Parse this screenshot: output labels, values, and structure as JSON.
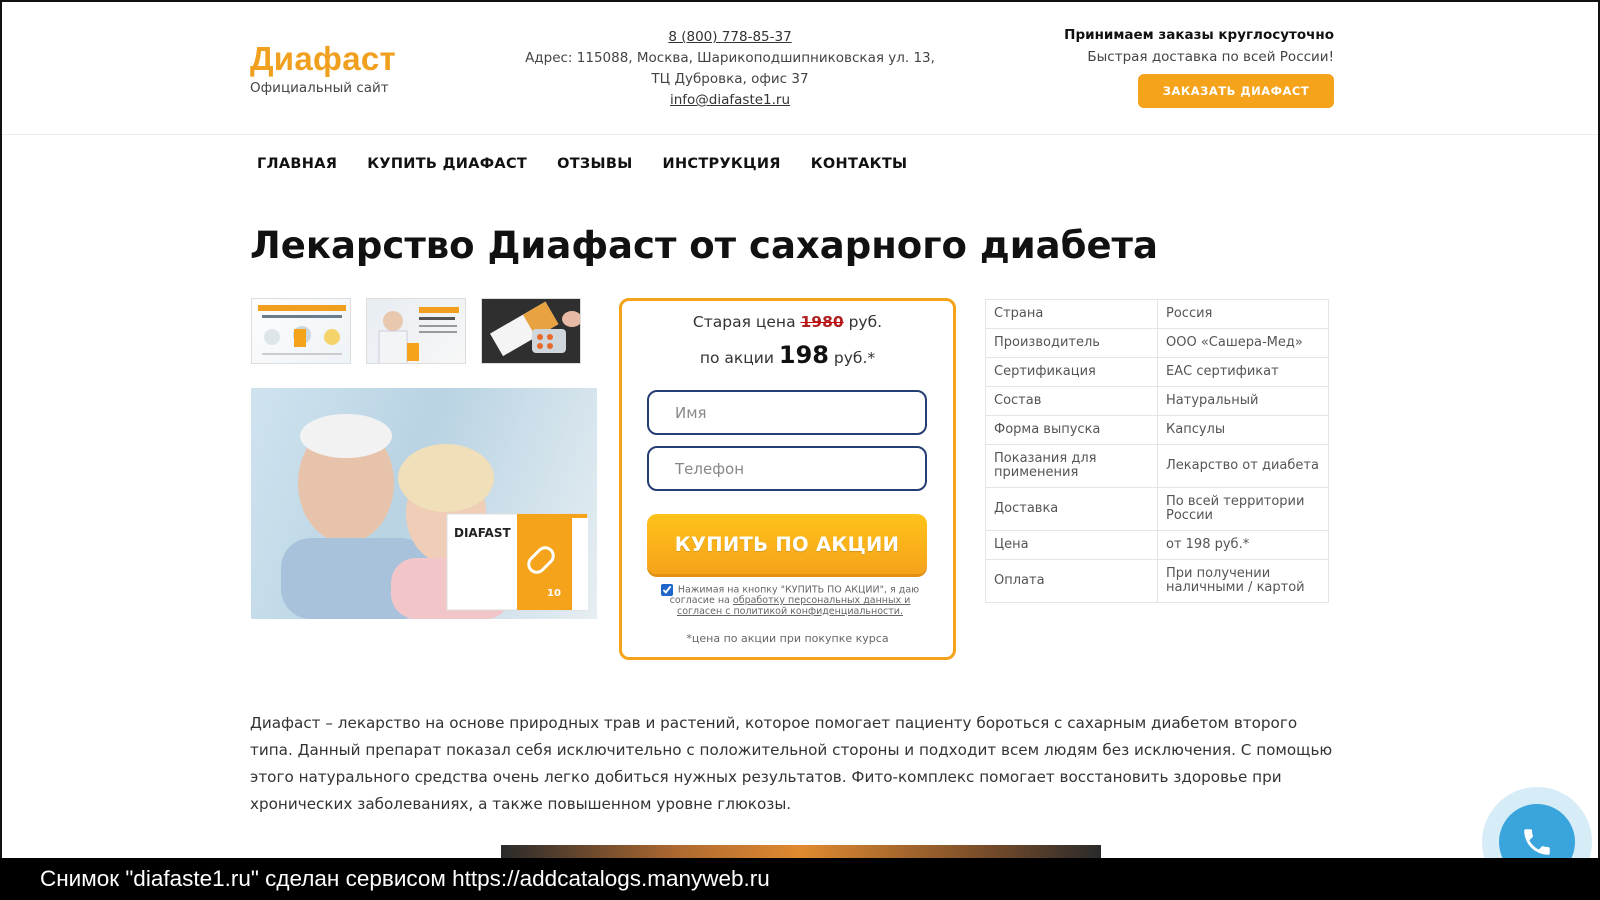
{
  "header": {
    "logo_title": "Диафаст",
    "logo_subtitle": "Официальный сайт",
    "phone": "8 (800) 778-85-37",
    "address_line1": "Адрес: 115088, Москва, Шарикоподшипниковская ул. 13,",
    "address_line2": "ТЦ Дубровка, офис 37",
    "email": "info@diafaste1.ru",
    "order_title": "Принимаем заказы круглосуточно",
    "order_subtitle": "Быстрая доставка по всей России!",
    "order_button": "ЗАКАЗАТЬ ДИАФАСТ"
  },
  "nav": {
    "items": [
      "ГЛАВНАЯ",
      "КУПИТЬ ДИАФАСТ",
      "ОТЗЫВЫ",
      "ИНСТРУКЦИЯ",
      "КОНТАКТЫ"
    ]
  },
  "page_title": "Лекарство Диафаст от сахарного диабета",
  "product_image": {
    "box_label": "DIAFAST",
    "box_count": "10"
  },
  "form": {
    "old_price_prefix": "Старая цена",
    "old_price_value": "1980",
    "currency": "руб.",
    "promo_prefix": "по акции",
    "promo_value": "198",
    "promo_currency": "руб.*",
    "name_placeholder": "Имя",
    "phone_placeholder": "Телефон",
    "buy_button": "КУПИТЬ ПО АКЦИИ",
    "consent_text": "Нажимая на кнопку \"КУПИТЬ ПО АКЦИИ\", я даю согласие на",
    "consent_link": "обработку персональных данных и согласен с политикой конфиденциальности.",
    "consent_checked": true,
    "footnote": "*цена по акции при покупке курса"
  },
  "specs": [
    {
      "label": "Страна",
      "value": "Россия"
    },
    {
      "label": "Производитель",
      "value": "ООО «Сашера-Мед»"
    },
    {
      "label": "Сертификация",
      "value": "ЕАС сертификат"
    },
    {
      "label": "Состав",
      "value": "Натуральный"
    },
    {
      "label": "Форма выпуска",
      "value": "Капсулы"
    },
    {
      "label": "Показания для применения",
      "value": "Лекарство от диабета"
    },
    {
      "label": "Доставка",
      "value": "По всей территории России"
    },
    {
      "label": "Цена",
      "value": "от 198 руб.*"
    },
    {
      "label": "Оплата",
      "value": "При получении наличными / картой"
    }
  ],
  "description": "Диафаст – лекарство на основе природных трав и растений, которое помогает пациенту бороться с сахарным диабетом второго типа. Данный препарат показал себя исключительно с положительной стороны и подходит всем людям без исключения. С помощью этого натурального средства очень легко добиться нужных результатов. Фито-комплекс помогает восстановить здоровье при хронических заболеваниях, а также повышенном уровне глюкозы.",
  "caption": "Снимок \"diafaste1.ru\" сделан сервисом https://addcatalogs.manyweb.ru",
  "colors": {
    "accent": "#f5a31a",
    "field_border": "#243e73",
    "call_button": "#3aa4dd"
  }
}
